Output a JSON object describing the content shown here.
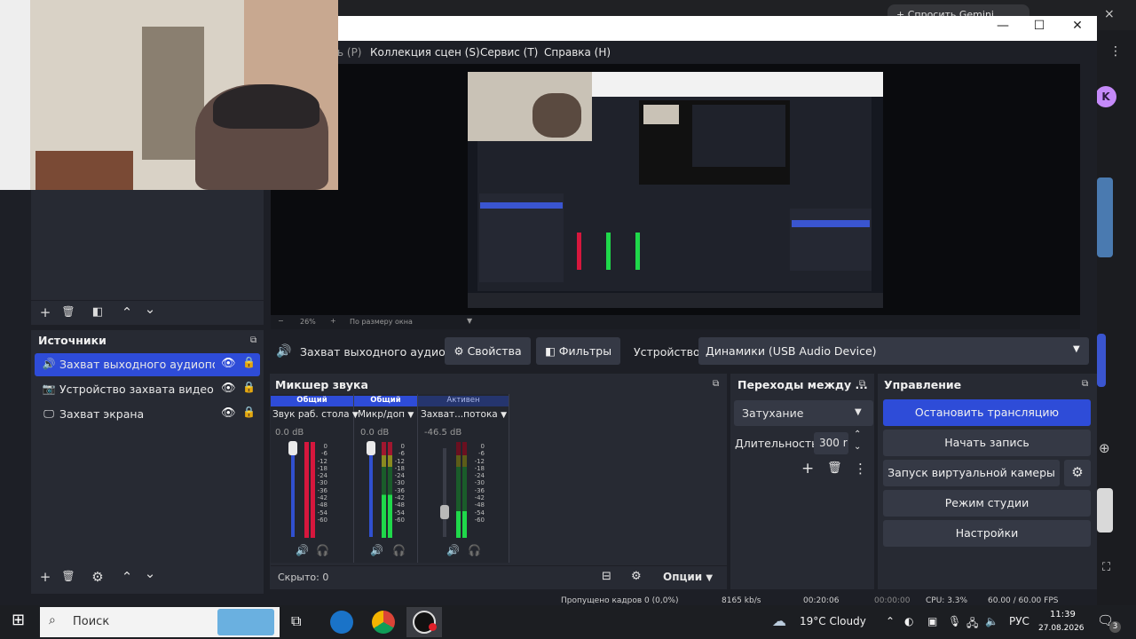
{
  "browser": {
    "tab_title": "+ Спросить Gemini",
    "close_glyph": "×",
    "menu_glyph": "⋮",
    "avatar_letter": "K"
  },
  "window": {
    "minimize": "—",
    "maximize": "☐",
    "close": "✕"
  },
  "menubar": {
    "items": [
      "ь (P)",
      "Коллекция сцен (S)",
      "Сервис (T)",
      "Справка (H)"
    ]
  },
  "preview": {
    "zoom_minus": "−",
    "zoom_value": "26%",
    "zoom_plus": "+",
    "zoom_mode": "По размеру окна",
    "zoom_mode_caret": "▼"
  },
  "scenes_toolbar": {
    "add": "+",
    "delete": "🗑",
    "filter": "◧",
    "up": "⌃",
    "down": "⌄"
  },
  "sources": {
    "title": "Источники",
    "items": [
      {
        "label": "Захват выходного аудиопото",
        "icon": "speaker-icon",
        "glyph": "🔊",
        "selected": true
      },
      {
        "label": "Устройство захвата видео",
        "icon": "camera-icon",
        "glyph": "📷",
        "selected": false
      },
      {
        "label": "Захват экрана",
        "icon": "monitor-icon",
        "glyph": "🖵",
        "selected": false
      }
    ],
    "eye": "👁",
    "lock": "🔒",
    "toolbar": {
      "add": "+",
      "delete": "🗑",
      "settings": "⚙",
      "up": "⌃",
      "down": "⌄"
    }
  },
  "context_bar": {
    "source_name": "Захват выходного аудиог",
    "properties": "Свойства",
    "filters": "Фильтры",
    "device_label": "Устройство",
    "device_value": "Динамики (USB Audio Device)"
  },
  "mixer": {
    "title": "Микшер звука",
    "channels": [
      {
        "tag": "Общий",
        "name": "Звук раб. стола",
        "db": "0.0 dB",
        "level": 1.0
      },
      {
        "tag": "Общий",
        "name": "Микр/доп",
        "db": "0.0 dB",
        "level": 1.0
      },
      {
        "tag": "Активен",
        "name": "Захват...потока",
        "db": "-46.5 dB",
        "level": 0.22
      }
    ],
    "ticks": [
      "0",
      "-6",
      "-12",
      "-18",
      "-24",
      "-30",
      "-36",
      "-42",
      "-48",
      "-54",
      "-60"
    ],
    "hidden": "Скрыто: 0",
    "options": "Опции"
  },
  "transitions": {
    "title": "Переходы между ...",
    "type": "Затухание",
    "duration_label": "Длительность",
    "duration_value": "300 r"
  },
  "controls": {
    "title": "Управление",
    "stop_stream": "Остановить трансляцию",
    "start_record": "Начать запись",
    "virtual_cam": "Запуск виртуальной камеры",
    "studio_mode": "Режим студии",
    "settings": "Настройки"
  },
  "statusbar": {
    "dropped": "Пропущено кадров 0 (0,0%)",
    "bitrate": "8165 kb/s",
    "live": "00:20:06",
    "rec": "00:00:00",
    "cpu": "CPU: 3.3%",
    "fps": "60.00 / 60.00 FPS"
  },
  "taskbar": {
    "search": "Поиск",
    "weather": "19°C  Cloudy",
    "lang": "РУС",
    "time": "11:39",
    "date": "27.08.2026",
    "notifications": "3"
  },
  "colors": {
    "accent": "#2e4cd8",
    "panel": "#272a33",
    "button": "#353945",
    "meter_red": "#d6173d",
    "meter_green": "#1fd84a",
    "meter_yellow": "#c9c22a"
  }
}
